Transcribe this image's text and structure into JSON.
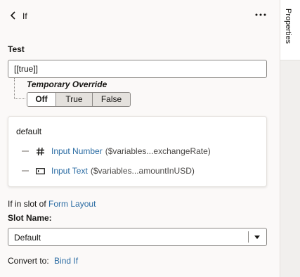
{
  "header": {
    "title": "If"
  },
  "side_panel": {
    "tab_label": "Properties"
  },
  "test": {
    "label": "Test",
    "value": "[[true]]",
    "override_label": "Temporary Override",
    "options": [
      "Off",
      "True",
      "False"
    ],
    "selected": "Off"
  },
  "card": {
    "title": "default",
    "items": [
      {
        "icon": "hash-icon",
        "name": "Input Number",
        "detail": "($variables...exchangeRate)"
      },
      {
        "icon": "input-text-icon",
        "name": "Input Text",
        "detail": "($variables...amountInUSD)"
      }
    ]
  },
  "slot": {
    "prefix": "If in slot of",
    "link": "Form Layout",
    "name_label": "Slot Name:",
    "selected": "Default"
  },
  "convert": {
    "label": "Convert to:",
    "link": "Bind If"
  },
  "colors": {
    "link": "#2b6ca3",
    "panel_bg": "#fbf9f8",
    "segment_bg": "#e4e1dd"
  }
}
